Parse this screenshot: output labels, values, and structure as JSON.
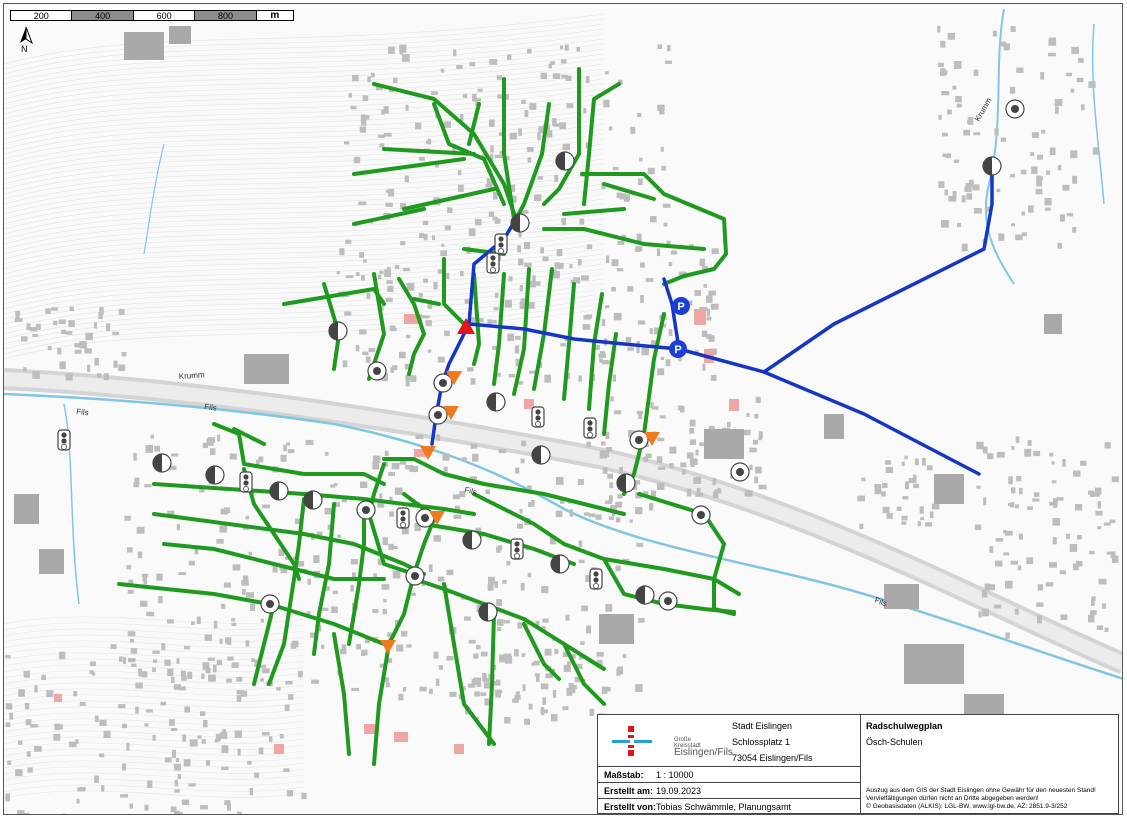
{
  "scalebar": {
    "labels": [
      "200",
      "400",
      "600",
      "800"
    ],
    "unit": "m"
  },
  "north": {
    "label": "N"
  },
  "street_labels": [
    "Fils",
    "Fils",
    "Fils",
    "Krumm",
    "Fils",
    "Krumm"
  ],
  "infobox": {
    "logo_text_line1": "Große Kreisstadt",
    "logo_text_line2": "Eislingen/Fils",
    "address_city": "Stadt Eislingen",
    "address_street": "Schlossplatz 1",
    "address_zip": "73054 Eislingen/Fils",
    "scale_label": "Maßstab:",
    "scale_value": "1 : 10000",
    "created_label": "Erstellt am:",
    "created_value": "19.09.2023",
    "author_label": "Erstellt von:",
    "author_value": "Tobias Schwämmle, Planungsamt",
    "plan_title": "Radschulwegplan",
    "plan_subtitle": "Ösch-Schulen",
    "disclaimer_1": "Auszug aus dem GIS der Stadt Eislingen ohne Gewähr für den neuesten Stand!",
    "disclaimer_2": "Vervielfältigungen dürfen nicht an Dritte abgegeben werden!",
    "disclaimer_3": "© Geobasisdaten (ALKIS): LGL-BW, www.lgl-bw.de, AZ: 2851.9-3/252"
  },
  "symbols": {
    "parking_label": "P"
  },
  "colors": {
    "green_route": "#1f9a1f",
    "blue_route": "#1535c4",
    "river": "#7fc6e6",
    "warning_red": "#e3151b",
    "warning_orange": "#f07a1e",
    "parking_blue": "#1c3fd8",
    "building": "#b8b8b8",
    "road_bg": "#ffffff"
  }
}
